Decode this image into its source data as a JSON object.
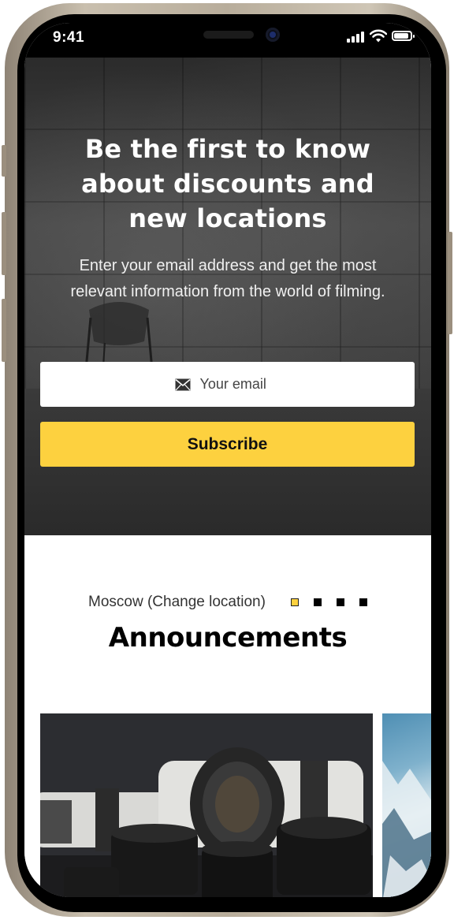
{
  "status_bar": {
    "time": "9:41"
  },
  "hero": {
    "title_lines": [
      "Be the first to know",
      "about discounts and",
      "new locations"
    ],
    "subtitle_lines": [
      "Enter your email address and get the most",
      "relevant information from the world of filming."
    ],
    "email_placeholder": "Your email",
    "subscribe_label": "Subscribe",
    "icon": "mail-icon"
  },
  "announcements": {
    "location_text": "Moscow (Change location)",
    "pagination": {
      "count": 4,
      "active_index": 0
    },
    "title": "Announcements",
    "cards": [
      {
        "image": "camera-lenses-photo"
      },
      {
        "image": "mountain-snow-photo"
      }
    ]
  },
  "colors": {
    "accent": "#fdd13f",
    "hero_bg": "#3a3a3a",
    "text_dark": "#000000"
  }
}
